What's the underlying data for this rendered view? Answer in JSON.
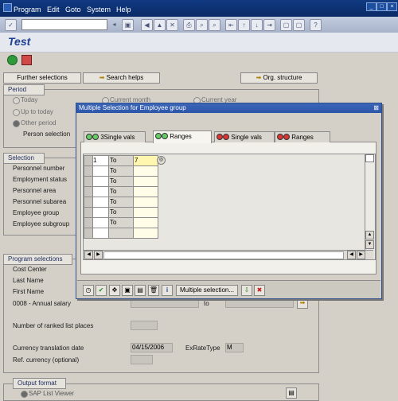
{
  "menu": {
    "program": "Program",
    "edit": "Edit",
    "goto": "Goto",
    "system": "System",
    "help": "Help"
  },
  "window": {
    "title": "Test"
  },
  "buttons": {
    "further_selections": "Further selections",
    "search_helps": "Search helps",
    "org_structure": "Org. structure"
  },
  "period": {
    "title": "Period",
    "today": "Today",
    "up_to_today": "Up to today",
    "other_period": "Other period",
    "current_month": "Current month",
    "current_year": "Current year",
    "person_selection": "Person selection"
  },
  "selection": {
    "title": "Selection",
    "personnel_number": "Personnel number",
    "employment_status": "Employment status",
    "personnel_area": "Personnel area",
    "personnel_subarea": "Personnel subarea",
    "employee_group": "Employee group",
    "employee_subgroup": "Employee subgroup"
  },
  "program_selections": {
    "title": "Program selections",
    "cost_center": "Cost Center",
    "last_name": "Last Name",
    "first_name": "First Name",
    "annual_salary": "0008 - Annual salary",
    "to": "to",
    "ranked_places": "Number of ranked list places",
    "currency_date": "Currency translation date",
    "currency_date_value": "04/15/2006",
    "ex_rate_type": "ExRateType",
    "ex_rate_value": "M",
    "ref_currency": "Ref. currency (optional)"
  },
  "output": {
    "title": "Output format",
    "sap_list_viewer": "SAP List Viewer"
  },
  "dialog": {
    "title": "Multiple Selection for Employee group",
    "tabs": [
      "3Single vals",
      "Ranges",
      "Single vals",
      "Ranges"
    ],
    "rows": [
      {
        "low": "1",
        "to": "To",
        "high": "7"
      },
      {
        "low": "",
        "to": "To",
        "high": ""
      },
      {
        "low": "",
        "to": "To",
        "high": ""
      },
      {
        "low": "",
        "to": "To",
        "high": ""
      },
      {
        "low": "",
        "to": "To",
        "high": ""
      },
      {
        "low": "",
        "to": "To",
        "high": ""
      },
      {
        "low": "",
        "to": "To",
        "high": ""
      },
      {
        "low": "",
        "to": "",
        "high": ""
      }
    ],
    "multiple_selection": "Multiple selection..."
  }
}
